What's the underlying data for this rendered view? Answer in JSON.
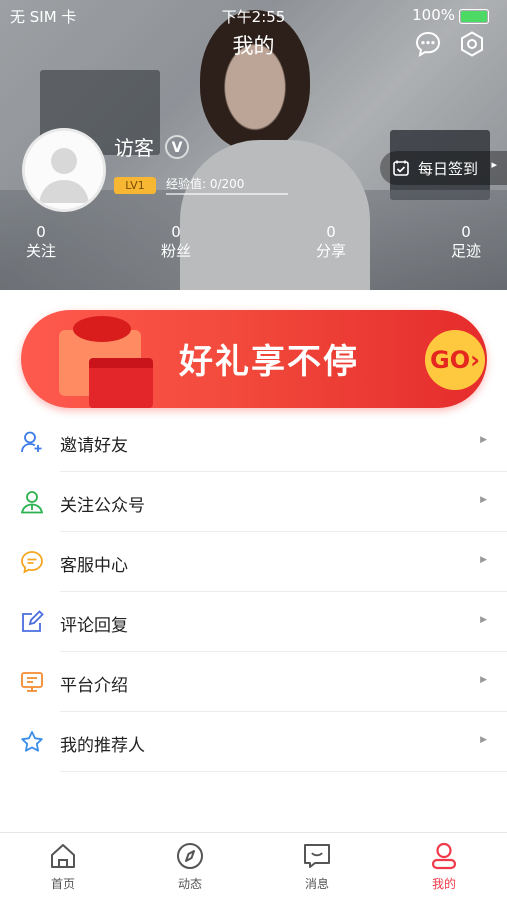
{
  "status_bar": {
    "carrier": "无 SIM 卡",
    "time": "下午2:55",
    "battery": "100%"
  },
  "header": {
    "title": "我的"
  },
  "profile": {
    "name": "访客",
    "level": "LV1",
    "badge": "V",
    "exp_label": "经验值: 0/200",
    "exp_progress": 0
  },
  "sign_in": {
    "label": "每日签到",
    "arrow": "▸"
  },
  "stats": [
    {
      "value": "0",
      "label": "关注"
    },
    {
      "value": "0",
      "label": "粉丝"
    },
    {
      "value": "0",
      "label": "分享"
    },
    {
      "value": "0",
      "label": "足迹"
    }
  ],
  "banner": {
    "text": "好礼享不停",
    "go": "GO›"
  },
  "menu": [
    {
      "label": "邀请好友",
      "icon": "add-user-icon",
      "color": "#3b7be8"
    },
    {
      "label": "关注公众号",
      "icon": "account-icon",
      "color": "#2bb24c"
    },
    {
      "label": "客服中心",
      "icon": "chat-bubble-icon",
      "color": "#f5a623"
    },
    {
      "label": "评论回复",
      "icon": "edit-icon",
      "color": "#4a6ee0"
    },
    {
      "label": "平台介绍",
      "icon": "monitor-icon",
      "color": "#f28b30"
    },
    {
      "label": "我的推荐人",
      "icon": "star-icon",
      "color": "#3b8de8"
    }
  ],
  "tabs": [
    {
      "label": "首页",
      "icon": "home-icon"
    },
    {
      "label": "动态",
      "icon": "compass-icon"
    },
    {
      "label": "消息",
      "icon": "message-icon"
    },
    {
      "label": "我的",
      "icon": "user-icon",
      "active": true
    }
  ],
  "colors": {
    "accent": "#f03a4a",
    "banner": "#f24a3c",
    "level_badge": "#f7b733"
  }
}
